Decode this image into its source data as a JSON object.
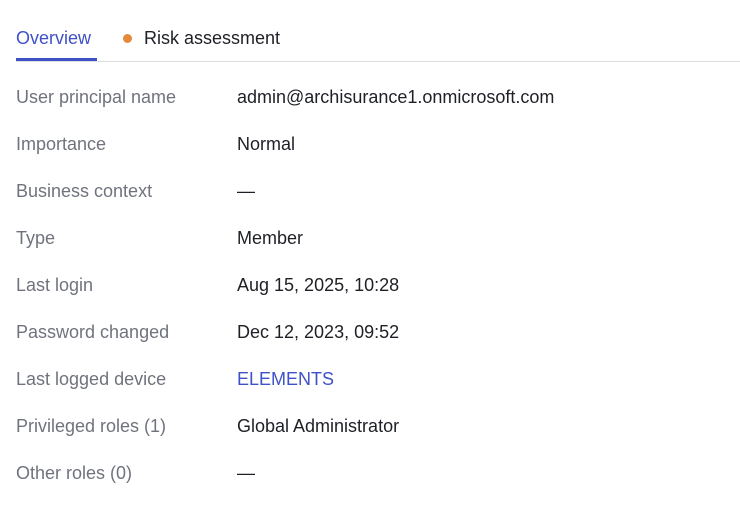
{
  "tabs": {
    "overview": "Overview",
    "risk_assessment": "Risk assessment",
    "risk_status_color": "#e38a3a",
    "active_color": "#3f51c8"
  },
  "details": {
    "user_principal_name": {
      "label": "User principal name",
      "value": "admin@archisurance1.onmicrosoft.com"
    },
    "importance": {
      "label": "Importance",
      "value": "Normal"
    },
    "business_context": {
      "label": "Business context",
      "value": "—"
    },
    "type": {
      "label": "Type",
      "value": "Member"
    },
    "last_login": {
      "label": "Last login",
      "value": "Aug 15, 2025, 10:28"
    },
    "password_changed": {
      "label": "Password changed",
      "value": "Dec 12, 2023, 09:52"
    },
    "last_logged_device": {
      "label": "Last logged device",
      "value": "ELEMENTS"
    },
    "privileged_roles": {
      "label": "Privileged roles (1)",
      "value": "Global Administrator"
    },
    "other_roles": {
      "label": "Other roles (0)",
      "value": "—"
    }
  }
}
